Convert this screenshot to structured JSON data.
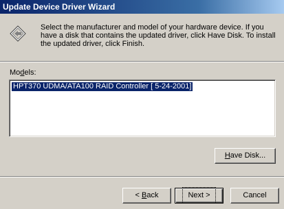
{
  "window": {
    "title": "Update Device Driver Wizard"
  },
  "header": {
    "icon": "wizard-diamond-icon",
    "description": "Select the manufacturer and model of your hardware device. If you have a disk that contains the updated driver, click Have Disk. To install the updated driver, click Finish."
  },
  "models": {
    "label_prefix": "Mo",
    "label_accel": "d",
    "label_suffix": "els:",
    "items": [
      {
        "label": "HPT370 UDMA/ATA100 RAID Controller [ 5-24-2001]",
        "selected": true
      }
    ]
  },
  "buttons": {
    "have_disk_accel": "H",
    "have_disk_rest": "ave Disk...",
    "back_prefix": "< ",
    "back_accel": "B",
    "back_rest": "ack",
    "next": "Next >",
    "cancel": "Cancel"
  }
}
